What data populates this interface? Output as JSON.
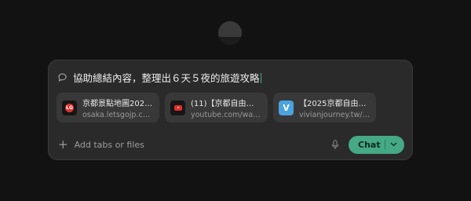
{
  "composer": {
    "prompt": "協助總結內容，整理出６天５夜的旅遊攻略",
    "add_label": "Add tabs or files",
    "chat_label": "Chat"
  },
  "tabs": [
    {
      "title": "京都景點地圖2025...",
      "url": "osaka.letsgojp.com...",
      "icon": "letsgojp-icon"
    },
    {
      "title": "(11)【京都自由行】...",
      "url": "youtube.com/watch...",
      "icon": "youtube-icon"
    },
    {
      "title": "【2025京都自由行】...",
      "url": "vivianjourney.tw/ky...",
      "icon": "vivianjourney-icon"
    }
  ],
  "colors": {
    "background": "#121212",
    "composer": "#2a2a2a",
    "accent": "#45a985"
  }
}
